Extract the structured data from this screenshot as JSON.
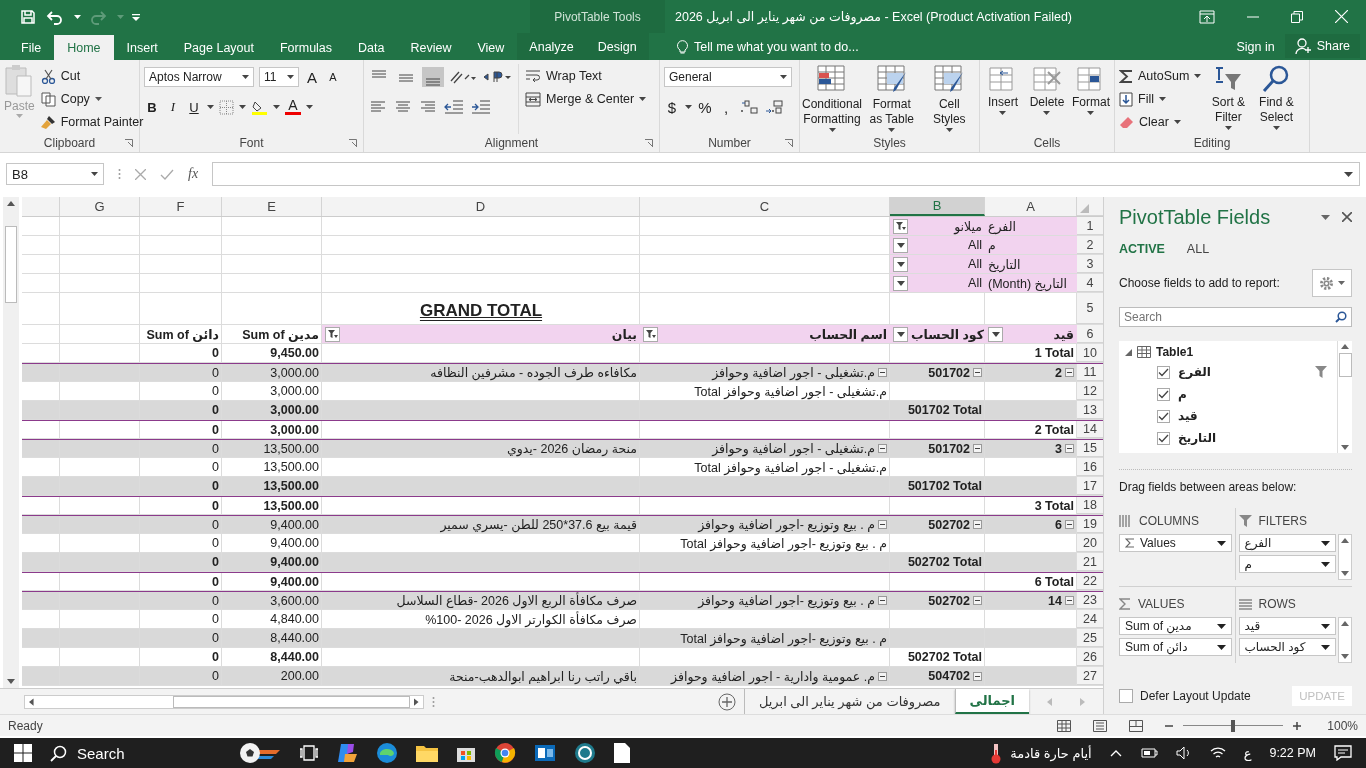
{
  "title_bar": {
    "context_label": "PivotTable Tools",
    "title": "مصروفات من شهر يناير الى ابريل 2026 - Excel (Product Activation Failed)"
  },
  "tabs": [
    {
      "label": "File",
      "selected": false,
      "contextual": false
    },
    {
      "label": "Home",
      "selected": true,
      "contextual": false
    },
    {
      "label": "Insert",
      "selected": false,
      "contextual": false
    },
    {
      "label": "Page Layout",
      "selected": false,
      "contextual": false
    },
    {
      "label": "Formulas",
      "selected": false,
      "contextual": false
    },
    {
      "label": "Data",
      "selected": false,
      "contextual": false
    },
    {
      "label": "Review",
      "selected": false,
      "contextual": false
    },
    {
      "label": "View",
      "selected": false,
      "contextual": false
    },
    {
      "label": "Analyze",
      "selected": false,
      "contextual": true
    },
    {
      "label": "Design",
      "selected": false,
      "contextual": true
    }
  ],
  "tell_me": "Tell me what you want to do...",
  "sign_in": "Sign in",
  "share": "Share",
  "ribbon": {
    "clipboard": {
      "label": "Clipboard",
      "paste": {
        "label": "Paste",
        "disabled": true
      },
      "cut": "Cut",
      "copy": "Copy",
      "format_painter": "Format Painter"
    },
    "font": {
      "label": "Font",
      "family": "Aptos Narrow",
      "size": "11",
      "grow": "A",
      "shrink": "A",
      "bold": "B",
      "italic": "I",
      "underline": "U",
      "color_glyph": "A"
    },
    "alignment": {
      "label": "Alignment",
      "vertical": [
        {
          "selected": false
        },
        {
          "selected": false
        },
        {
          "selected": true
        }
      ],
      "wrap_text": "Wrap Text",
      "merge": "Merge & Center"
    },
    "number": {
      "label": "Number",
      "format": "General",
      "currency": "$",
      "percent": "%",
      "comma": ","
    },
    "styles": {
      "label": "Styles",
      "buttons": [
        "Conditional Formatting",
        "Format as Table",
        "Cell Styles"
      ]
    },
    "cells": {
      "label": "Cells",
      "buttons": [
        "Insert",
        "Delete",
        "Format"
      ]
    },
    "editing": {
      "label": "Editing",
      "autosum": "AutoSum",
      "fill": "Fill",
      "clear": "Clear",
      "sort": "Sort & Filter",
      "find": "Find & Select"
    }
  },
  "formula_bar": {
    "name_box": "B8",
    "function_label": "fx"
  },
  "sheet": {
    "columns": [
      {
        "label": "G",
        "selected": false
      },
      {
        "label": "F",
        "selected": false
      },
      {
        "label": "E",
        "selected": false
      },
      {
        "label": "D",
        "selected": false
      },
      {
        "label": "C",
        "selected": false
      },
      {
        "label": "B",
        "selected": true
      },
      {
        "label": "A",
        "selected": false
      }
    ],
    "rows": [
      {
        "kind": "filter",
        "num": "1",
        "field": "الفرع",
        "selection": "ميلانو",
        "filtered": true
      },
      {
        "kind": "filter",
        "num": "2",
        "field": "م",
        "selection": "All",
        "filtered": false
      },
      {
        "kind": "filter",
        "num": "3",
        "field": "التاريخ",
        "selection": "All",
        "filtered": false
      },
      {
        "kind": "filter",
        "num": "4",
        "field": "التاريخ (Month)",
        "selection": "All",
        "filtered": false
      },
      {
        "kind": "title",
        "num": "5",
        "text": "GRAND TOTAL"
      },
      {
        "kind": "header",
        "num": "6",
        "headers": {
          "a": {
            "text": "قيد",
            "filtered": false
          },
          "b": {
            "text": "كود الحساب",
            "filtered": false
          },
          "c": {
            "text": "اسم الحساب",
            "filtered": true
          },
          "d": {
            "text": "بيان",
            "filtered": true
          },
          "e": {
            "text": "Sum of مدين"
          },
          "f": {
            "text": "Sum of دائن"
          }
        }
      },
      {
        "kind": "data",
        "num": "10",
        "shaded": false,
        "total": true,
        "rule_above": false,
        "cells": {
          "a": {
            "text": "1 Total",
            "toggle": false
          },
          "e": {
            "text": "9,450.00"
          },
          "f": {
            "text": "0"
          }
        }
      },
      {
        "kind": "data",
        "num": "11",
        "shaded": true,
        "total": false,
        "rule_above": true,
        "cells": {
          "a": {
            "text": "2",
            "toggle": true
          },
          "b": {
            "text": "501702",
            "toggle": true
          },
          "c": {
            "text": "م.تشغيلى - اجور اضافية وحوافز",
            "toggle": true
          },
          "d": {
            "text": "مكافاءه طرف الجوده - مشرفين النظافه"
          },
          "e": {
            "text": "3,000.00"
          },
          "f": {
            "text": "0"
          }
        }
      },
      {
        "kind": "data",
        "num": "12",
        "shaded": false,
        "total": false,
        "rule_above": false,
        "cells": {
          "c": {
            "text": "م.تشغيلى - اجور اضافية وحوافز Total",
            "toggle": false
          },
          "e": {
            "text": "3,000.00"
          },
          "f": {
            "text": "0"
          }
        }
      },
      {
        "kind": "data",
        "num": "13",
        "shaded": true,
        "total": true,
        "rule_above": false,
        "cells": {
          "b": {
            "text": "501702 Total",
            "toggle": false
          },
          "e": {
            "text": "3,000.00"
          },
          "f": {
            "text": "0"
          }
        }
      },
      {
        "kind": "data",
        "num": "14",
        "shaded": false,
        "total": true,
        "rule_above": true,
        "cells": {
          "a": {
            "text": "2 Total",
            "toggle": false
          },
          "e": {
            "text": "3,000.00"
          },
          "f": {
            "text": "0"
          }
        }
      },
      {
        "kind": "data",
        "num": "15",
        "shaded": true,
        "total": false,
        "rule_above": true,
        "cells": {
          "a": {
            "text": "3",
            "toggle": true
          },
          "b": {
            "text": "501702",
            "toggle": true
          },
          "c": {
            "text": "م.تشغيلى - اجور اضافية وحوافز",
            "toggle": true
          },
          "d": {
            "text": "منحة رمضان 2026 -يدوي"
          },
          "e": {
            "text": "13,500.00"
          },
          "f": {
            "text": "0"
          }
        }
      },
      {
        "kind": "data",
        "num": "16",
        "shaded": false,
        "total": false,
        "rule_above": false,
        "cells": {
          "c": {
            "text": "م.تشغيلى - اجور اضافية وحوافز Total",
            "toggle": false
          },
          "e": {
            "text": "13,500.00"
          },
          "f": {
            "text": "0"
          }
        }
      },
      {
        "kind": "data",
        "num": "17",
        "shaded": true,
        "total": true,
        "rule_above": false,
        "cells": {
          "b": {
            "text": "501702 Total",
            "toggle": false
          },
          "e": {
            "text": "13,500.00"
          },
          "f": {
            "text": "0"
          }
        }
      },
      {
        "kind": "data",
        "num": "18",
        "shaded": false,
        "total": true,
        "rule_above": true,
        "cells": {
          "a": {
            "text": "3 Total",
            "toggle": false
          },
          "e": {
            "text": "13,500.00"
          },
          "f": {
            "text": "0"
          }
        }
      },
      {
        "kind": "data",
        "num": "19",
        "shaded": true,
        "total": false,
        "rule_above": true,
        "cells": {
          "a": {
            "text": "6",
            "toggle": true
          },
          "b": {
            "text": "502702",
            "toggle": true
          },
          "c": {
            "text": "م . بيع وتوزيع -اجور اضافية وحوافز",
            "toggle": true
          },
          "d": {
            "text": "قيمة بيع 37.6*250 للطن -يسري سمير"
          },
          "e": {
            "text": "9,400.00"
          },
          "f": {
            "text": "0"
          }
        }
      },
      {
        "kind": "data",
        "num": "20",
        "shaded": false,
        "total": false,
        "rule_above": false,
        "cells": {
          "c": {
            "text": "م . بيع وتوزيع -اجور اضافية وحوافز Total",
            "toggle": false
          },
          "e": {
            "text": "9,400.00"
          },
          "f": {
            "text": "0"
          }
        }
      },
      {
        "kind": "data",
        "num": "21",
        "shaded": true,
        "total": true,
        "rule_above": false,
        "cells": {
          "b": {
            "text": "502702 Total",
            "toggle": false
          },
          "e": {
            "text": "9,400.00"
          },
          "f": {
            "text": "0"
          }
        }
      },
      {
        "kind": "data",
        "num": "22",
        "shaded": false,
        "total": true,
        "rule_above": true,
        "cells": {
          "a": {
            "text": "6 Total",
            "toggle": false
          },
          "e": {
            "text": "9,400.00"
          },
          "f": {
            "text": "0"
          }
        }
      },
      {
        "kind": "data",
        "num": "23",
        "shaded": true,
        "total": false,
        "rule_above": true,
        "cells": {
          "a": {
            "text": "14",
            "toggle": true
          },
          "b": {
            "text": "502702",
            "toggle": true
          },
          "c": {
            "text": "م . بيع وتوزيع -اجور اضافية وحوافز",
            "toggle": true
          },
          "d": {
            "text": "صرف مكافأة الربع الاول 2026 -قطاع السلاسل"
          },
          "e": {
            "text": "3,600.00"
          },
          "f": {
            "text": "0"
          }
        }
      },
      {
        "kind": "data",
        "num": "24",
        "shaded": false,
        "total": false,
        "rule_above": false,
        "cells": {
          "d": {
            "text": "صرف مكافأة الكوارتر الاول 2026 -100%"
          },
          "e": {
            "text": "4,840.00"
          },
          "f": {
            "text": "0"
          }
        }
      },
      {
        "kind": "data",
        "num": "25",
        "shaded": true,
        "total": false,
        "rule_above": false,
        "cells": {
          "c": {
            "text": "م . بيع وتوزيع -اجور اضافية وحوافز Total",
            "toggle": false
          },
          "e": {
            "text": "8,440.00"
          },
          "f": {
            "text": "0"
          }
        }
      },
      {
        "kind": "data",
        "num": "26",
        "shaded": false,
        "total": true,
        "rule_above": false,
        "cells": {
          "b": {
            "text": "502702 Total",
            "toggle": false
          },
          "e": {
            "text": "8,440.00"
          },
          "f": {
            "text": "0"
          }
        }
      },
      {
        "kind": "data",
        "num": "27",
        "shaded": true,
        "total": false,
        "rule_above": false,
        "cells": {
          "b": {
            "text": "504702",
            "toggle": true
          },
          "c": {
            "text": "م. عمومية وادارية - اجور اضافية وحوافز",
            "toggle": true
          },
          "d": {
            "text": "باقي راتب رنا ابراهيم ابوالدهب-منحة"
          },
          "e": {
            "text": "200.00"
          },
          "f": {
            "text": "0"
          }
        }
      }
    ]
  },
  "sheet_tabs": [
    {
      "label": "اجمالى",
      "selected": true
    },
    {
      "label": "مصروفات من شهر يناير الى ابريل",
      "selected": false
    }
  ],
  "pivot_pane": {
    "title": "PivotTable Fields",
    "tabs": [
      {
        "label": "ACTIVE",
        "selected": true
      },
      {
        "label": "ALL",
        "selected": false
      }
    ],
    "choose_label": "Choose fields to add to report:",
    "search": {
      "placeholder": "Search"
    },
    "table": {
      "name": "Table1",
      "expanded": true,
      "children": [
        {
          "label": "الفرع",
          "checked": true,
          "filtered": true
        },
        {
          "label": "م",
          "checked": true,
          "filtered": false
        },
        {
          "label": "قيد",
          "checked": true,
          "filtered": false
        },
        {
          "label": "التاريخ",
          "checked": true,
          "filtered": false
        }
      ]
    },
    "drag_label": "Drag fields between areas below:",
    "areas": [
      {
        "kind": "columns",
        "title": "COLUMNS",
        "items": [
          "Values"
        ]
      },
      {
        "kind": "filters",
        "title": "FILTERS",
        "items": [
          "الفرع",
          "م"
        ]
      },
      {
        "kind": "values",
        "title": "VALUES",
        "items": [
          "Sum of مدين",
          "Sum of دائن"
        ]
      },
      {
        "kind": "rows",
        "title": "ROWS",
        "items": [
          "قيد",
          "كود الحساب"
        ]
      }
    ],
    "defer": {
      "label": "Defer Layout Update",
      "checked": false
    },
    "update": {
      "label": "UPDATE",
      "disabled": true
    }
  },
  "status_bar": {
    "mode": "Ready",
    "zoom": "100%",
    "zoom_slider": {
      "level": 0.5
    }
  },
  "taskbar": {
    "search": "Search",
    "weather": "أيام حارة قادمة",
    "language": "ع",
    "time": "9:22 PM"
  }
}
